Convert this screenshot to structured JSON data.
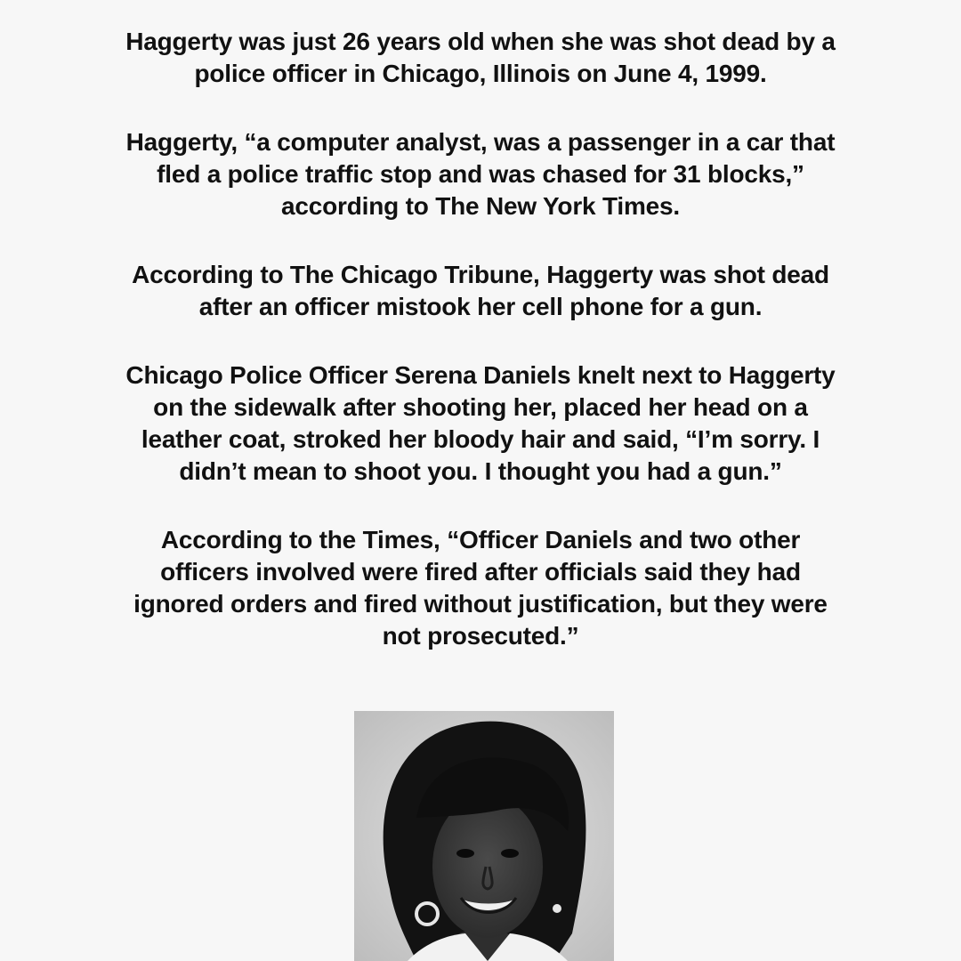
{
  "paragraphs": [
    {
      "lines": [
        "Haggerty was just 26 years old when she was shot dead by a",
        "police officer in Chicago, Illinois on June 4, 1999."
      ]
    },
    {
      "lines": [
        "Haggerty, “a computer analyst, was a passenger in a car that",
        "fled a police traffic stop and was chased for 31 blocks,”",
        "according to The New York Times."
      ]
    },
    {
      "lines": [
        "According to The Chicago Tribune, Haggerty was shot dead",
        "after an officer mistook her cell phone for a gun."
      ]
    },
    {
      "lines": [
        "Chicago Police Officer Serena Daniels knelt next to Haggerty",
        "on the sidewalk after shooting her, placed her head on a",
        "leather coat, stroked her bloody hair and said, “I’m sorry. I",
        "didn’t mean to shoot you. I thought you had a gun.”"
      ]
    },
    {
      "lines": [
        "According to the Times, “Officer Daniels and two other",
        "officers involved were fired after officials said they had",
        "ignored orders and fired without justification, but they were",
        "not prosecuted.”"
      ]
    }
  ],
  "photo": {
    "icon": "portrait-photo",
    "colors": {
      "background": "#d4d4d4",
      "hair": "#121212",
      "skin": "#3a3a3a"
    }
  }
}
